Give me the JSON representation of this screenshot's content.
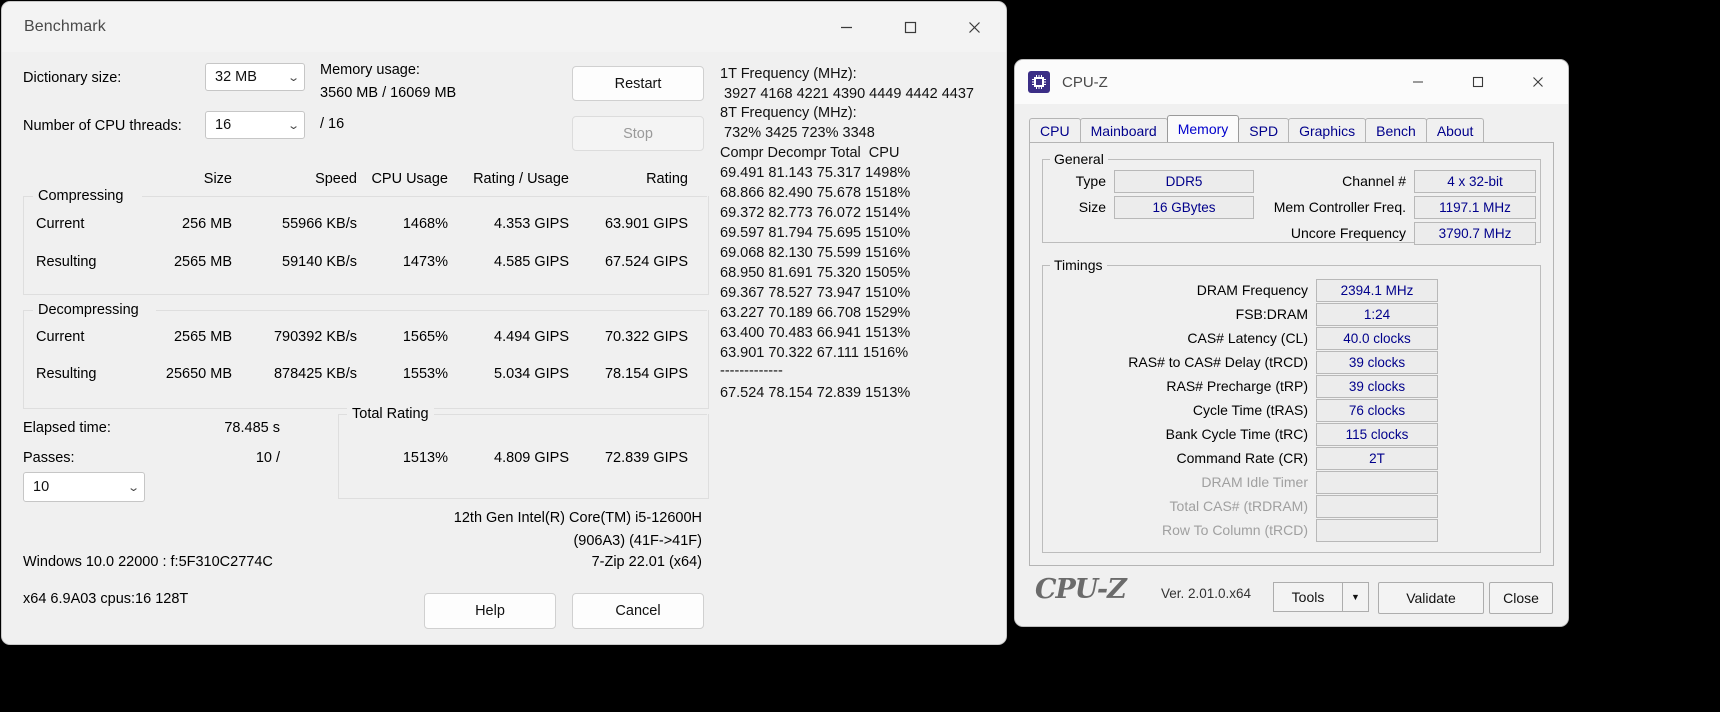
{
  "sevenzip": {
    "title": "Benchmark",
    "window_controls": {
      "minimize": "—",
      "maximize": "☐",
      "close": "✕"
    },
    "dictionary_label": "Dictionary size:",
    "dictionary_value": "32 MB",
    "threads_label": "Number of CPU threads:",
    "threads_value": "16",
    "threads_total": "/ 16",
    "memory_usage_label": "Memory usage:",
    "memory_usage_value": "3560 MB / 16069 MB",
    "restart_button": "Restart",
    "stop_button": "Stop",
    "columns": [
      "Size",
      "Speed",
      "CPU Usage",
      "Rating / Usage",
      "Rating"
    ],
    "compressing_caption": "Compressing",
    "decompressing_caption": "Decompressing",
    "compressing_rows": [
      {
        "name": "Current",
        "size": "256 MB",
        "speed": "55966 KB/s",
        "cpu": "1468%",
        "rating_usage": "4.353 GIPS",
        "rating": "63.901 GIPS"
      },
      {
        "name": "Resulting",
        "size": "2565 MB",
        "speed": "59140 KB/s",
        "cpu": "1473%",
        "rating_usage": "4.585 GIPS",
        "rating": "67.524 GIPS"
      }
    ],
    "decompressing_rows": [
      {
        "name": "Current",
        "size": "2565 MB",
        "speed": "790392 KB/s",
        "cpu": "1565%",
        "rating_usage": "4.494 GIPS",
        "rating": "70.322 GIPS"
      },
      {
        "name": "Resulting",
        "size": "25650 MB",
        "speed": "878425 KB/s",
        "cpu": "1553%",
        "rating_usage": "5.034 GIPS",
        "rating": "78.154 GIPS"
      }
    ],
    "elapsed_label": "Elapsed time:",
    "elapsed_value": "78.485 s",
    "passes_label": "Passes:",
    "passes_value": "10 /",
    "passes_select": "10",
    "total_rating_caption": "Total Rating",
    "total_rating_cpu": "1513%",
    "total_rating_usage": "4.809 GIPS",
    "total_rating_value": "72.839 GIPS",
    "cpu_name_line1": "12th Gen Intel(R) Core(TM) i5-12600H",
    "cpu_name_line2": "(906A3) (41F->41F)",
    "os_line": "Windows 10.0 22000 :  f:5F310C2774C",
    "app_version": "7-Zip 22.01 (x64)",
    "build_line": "x64 6.9A03 cpus:16 128T",
    "help_button": "Help",
    "cancel_button": "Cancel",
    "log": {
      "freq1t_label": "1T Frequency (MHz):",
      "freq1t_values": " 3927 4168 4221 4390 4449 4442 4437",
      "freq8t_label": "8T Frequency (MHz):",
      "freq8t_values": " 732% 3425 723% 3348",
      "header": "Compr Decompr Total  CPU",
      "rows": [
        "69.491 81.143 75.317 1498%",
        "68.866 82.490 75.678 1518%",
        "69.372 82.773 76.072 1514%",
        "69.597 81.794 75.695 1510%",
        "69.068 82.130 75.599 1516%",
        "68.950 81.691 75.320 1505%",
        "69.367 78.527 73.947 1510%",
        "63.227 70.189 66.708 1529%",
        "63.400 70.483 66.941 1513%",
        "63.901 70.322 67.111 1516%"
      ],
      "divider": "-------------",
      "total": "67.524 78.154 72.839 1513%"
    }
  },
  "cpuz": {
    "title": "CPU-Z",
    "window_controls": {
      "minimize": "—",
      "maximize": "☐",
      "close": "✕"
    },
    "tabs": [
      {
        "label": "CPU",
        "active": false
      },
      {
        "label": "Mainboard",
        "active": false
      },
      {
        "label": "Memory",
        "active": true
      },
      {
        "label": "SPD",
        "active": false
      },
      {
        "label": "Graphics",
        "active": false
      },
      {
        "label": "Bench",
        "active": false
      },
      {
        "label": "About",
        "active": false
      }
    ],
    "general": {
      "caption": "General",
      "left": [
        {
          "label": "Type",
          "value": "DDR5"
        },
        {
          "label": "Size",
          "value": "16 GBytes"
        }
      ],
      "right": [
        {
          "label": "Channel #",
          "value": "4 x 32-bit"
        },
        {
          "label": "Mem Controller Freq.",
          "value": "1197.1 MHz"
        },
        {
          "label": "Uncore Frequency",
          "value": "3790.7 MHz"
        }
      ]
    },
    "timings": {
      "caption": "Timings",
      "rows": [
        {
          "label": "DRAM Frequency",
          "value": "2394.1 MHz",
          "dim": false
        },
        {
          "label": "FSB:DRAM",
          "value": "1:24",
          "dim": false
        },
        {
          "label": "CAS# Latency (CL)",
          "value": "40.0 clocks",
          "dim": false
        },
        {
          "label": "RAS# to CAS# Delay (tRCD)",
          "value": "39 clocks",
          "dim": false
        },
        {
          "label": "RAS# Precharge (tRP)",
          "value": "39 clocks",
          "dim": false
        },
        {
          "label": "Cycle Time (tRAS)",
          "value": "76 clocks",
          "dim": false
        },
        {
          "label": "Bank Cycle Time (tRC)",
          "value": "115 clocks",
          "dim": false
        },
        {
          "label": "Command Rate (CR)",
          "value": "2T",
          "dim": false
        },
        {
          "label": "DRAM Idle Timer",
          "value": "",
          "dim": true
        },
        {
          "label": "Total CAS# (tRDRAM)",
          "value": "",
          "dim": true
        },
        {
          "label": "Row To Column (tRCD)",
          "value": "",
          "dim": true
        }
      ]
    },
    "footer": {
      "logo": "CPU-Z",
      "version": "Ver. 2.01.0.x64",
      "tools_button": "Tools",
      "tools_arrow": "▼",
      "validate_button": "Validate",
      "close_button": "Close"
    }
  }
}
